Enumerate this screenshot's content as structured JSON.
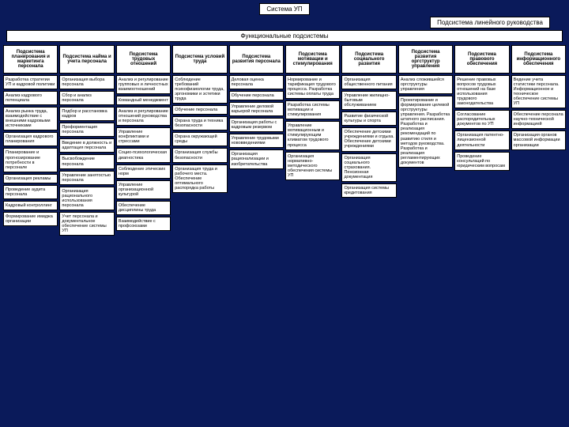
{
  "title": "Система УП",
  "subtitle": "Подсистема линейного руководства",
  "banner": "Функциональные подсистемы",
  "columns": [
    {
      "header": "Подсистема планирования и маркетинга персонала",
      "items": [
        "Разработка стратегии УП и кадровой политики",
        "Анализ кадрового потенциала",
        "Анализ рынка труда, взаимодействие с внешними кадровыми источниками",
        "Организация кадрового планирования",
        "Планирование и прогнозирование потребности в персонале",
        "Организация рекламы",
        "Проведение аудита персонала",
        "Кадровый контроллинг",
        "Формирование имиджа организации"
      ]
    },
    {
      "header": "Подсистема найма и учета персонала",
      "items": [
        "Организация выбора персонала",
        "Сбор и анализ персонала",
        "Подбор и расстановка кадров",
        "Профориентация персонала",
        "Введение в должность и адаптация персонала",
        "Высвобождение персонала",
        "Управление занятостью персонала",
        "Организация рационального использования персонала",
        "Учет персонала и документальное обеспечение системы УП"
      ]
    },
    {
      "header": "Подсистема трудовых отношений",
      "items": [
        "Анализ и регулирование групповых и личностных взаимоотношений",
        "Командный менеджмент",
        "Анализ и регулирование отношений руководства и персонала",
        "Управление конфликтами и стрессами",
        "Социо-психологическая диагностика",
        "Соблюдение этических норм",
        "Управление организационной культурой",
        "Обеспечение дисциплины труда",
        "Взаимодействие с профсоюзами"
      ]
    },
    {
      "header": "Подсистема условий труда",
      "items": [
        "Соблюдение требований психофизиологии труда, эргономики и эстетики труда",
        "Обучение персонала",
        "Охрана труда и техника безопасности",
        "Охрана окружающей среды",
        "Организация службы безопасности",
        "Организация труда и рабочего места. Обеспечение оптимального распорядка работы"
      ]
    },
    {
      "header": "Подсистема развития персонала",
      "items": [
        "Деловая оценка персонала",
        "Обучение персонала",
        "Управление деловой карьерой персонала",
        "Организация работы с кадровым резервом",
        "Управление трудовыми нововведениями",
        "Организация рационализации и изобретательства"
      ]
    },
    {
      "header": "Подсистема мотивации и стимулирования",
      "items": [
        "Нормирование и тарификация трудового процесса. Разработка системы оплаты труда",
        "Разработка системы мотивации и стимулирования",
        "Управление мотивационным и стимулирующим климатом трудового процесса",
        "Организация нормативно-методического обеспечения системы УП"
      ]
    },
    {
      "header": "Подсистема социального развития",
      "items": [
        "Организация общественного питания",
        "Управление жилищно-бытовым обслуживанием",
        "Развитие физической культуры и спорта",
        "Обеспечение детскими учреждениями и отдыха. Обеспечение детскими учреждениями",
        "Организация социального страхования. Пенсионная документация",
        "Организация системы кредитования"
      ]
    },
    {
      "header": "Подсистема развития оргструктур управления",
      "items": [
        "Анализ сложившейся оргструктуры управления",
        "Проектирование и формирование целевой оргструктуры управления. Разработка штатного расписания. Разработка и реализация рекомендаций по развитию стиля и методов руководства. Разработка и реализация регламентирующих документов"
      ]
    },
    {
      "header": "Подсистема правового обеспечения",
      "items": [
        "Решение правовых вопросов трудовых отношений на базе использования трудового законодательства",
        "Согласование распорядительных документов по УП",
        "Организация патентно-лицензионной деятельности",
        "Проведение консультаций по юридическим вопросам"
      ]
    },
    {
      "header": "Подсистема информационного обеспечения",
      "items": [
        "Ведение учета статистики персонала. Информационное и техническое обеспечение системы УП",
        "Обеспечение персонала научно-технической информацией",
        "Организация органов массовой информации организации"
      ]
    }
  ]
}
